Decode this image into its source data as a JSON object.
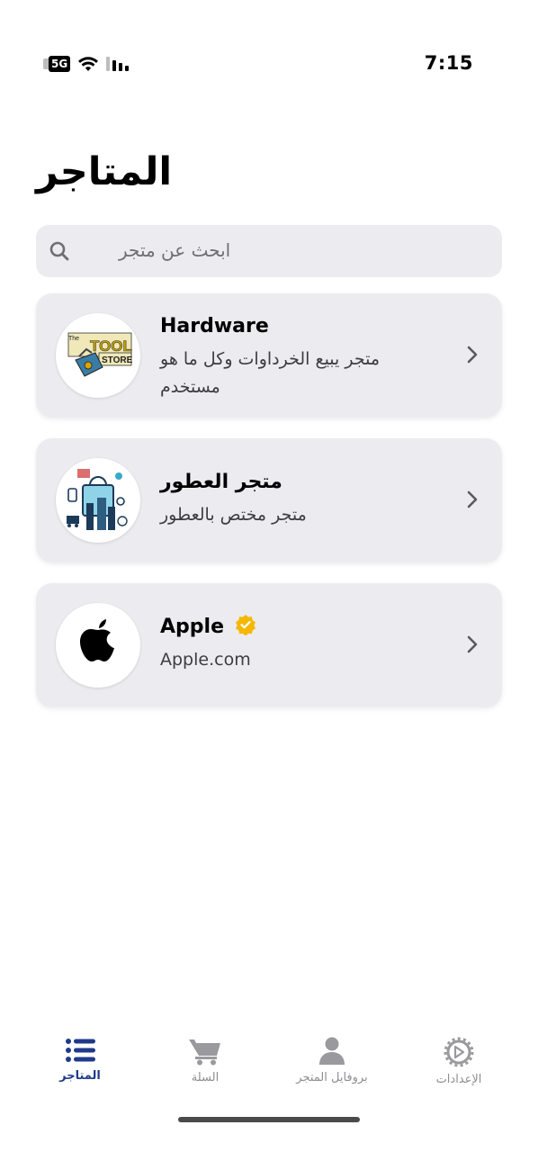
{
  "status_bar": {
    "time": "7:15",
    "network_badge": "5G",
    "icons": [
      "cellular-badge-icon",
      "wifi-icon",
      "signal-bars-icon"
    ]
  },
  "page": {
    "title": "المتاجر"
  },
  "search": {
    "placeholder": "ابحث عن متجر"
  },
  "stores": [
    {
      "name": "Hardware",
      "description": "متجر يبيع الخرداوات وكل ما هو مستخدم",
      "logo_text_top": "The TOOL",
      "logo_text_bottom": "STORE",
      "verified": false
    },
    {
      "name": "متجر العطور",
      "description": "متجر مختص بالعطور",
      "verified": false
    },
    {
      "name": "Apple",
      "description": "Apple.com",
      "verified": true
    }
  ],
  "tab_bar": {
    "items": [
      {
        "label": "المتاجر",
        "icon": "list-icon",
        "active": true
      },
      {
        "label": "السلة",
        "icon": "cart-icon",
        "active": false
      },
      {
        "label": "بروفايل المتجر",
        "icon": "person-icon",
        "active": false
      },
      {
        "label": "الإعدادات",
        "icon": "gear-icon",
        "active": false
      }
    ]
  },
  "colors": {
    "accent": "#1f3a8a",
    "card_background": "#ececf0",
    "verified_badge": "#f5b800",
    "inactive_tab": "#8e8e93"
  }
}
